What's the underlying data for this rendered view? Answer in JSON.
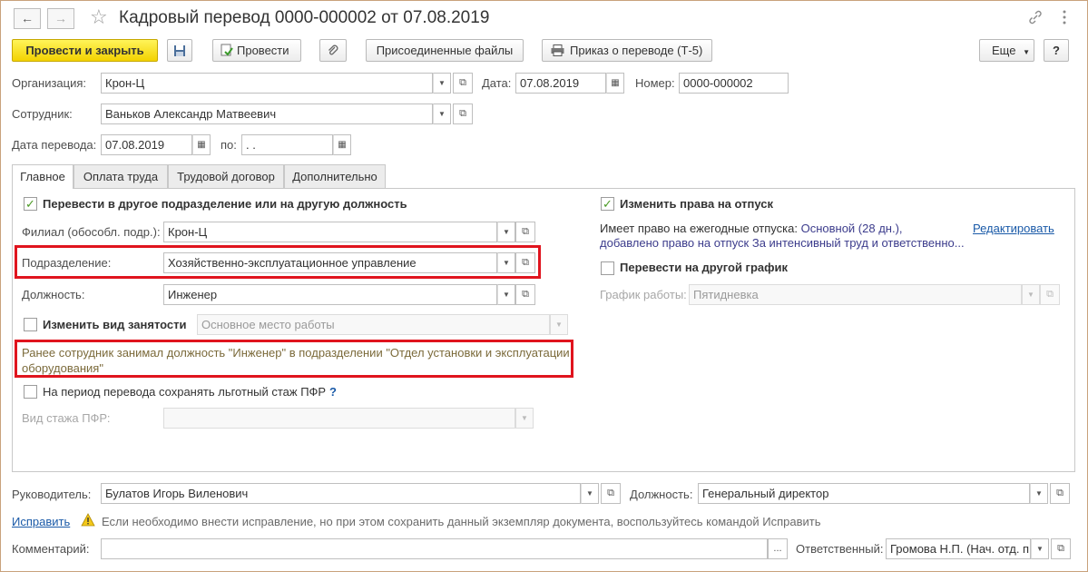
{
  "window": {
    "title": "Кадровый перевод 0000-000002 от 07.08.2019"
  },
  "toolbar": {
    "post_close": "Провести и закрыть",
    "post": "Провести",
    "attached_files": "Присоединенные файлы",
    "order": "Приказ о переводе (Т-5)",
    "more": "Еще",
    "help": "?"
  },
  "header": {
    "org_label": "Организация:",
    "org_value": "Крон-Ц",
    "date_label": "Дата:",
    "date_value": "07.08.2019",
    "number_label": "Номер:",
    "number_value": "0000-000002",
    "employee_label": "Сотрудник:",
    "employee_value": "Ваньков Александр Матвеевич",
    "transfer_date_label": "Дата перевода:",
    "transfer_date_value": "07.08.2019",
    "to_label": "по:",
    "to_value": " .  ."
  },
  "tabs": [
    {
      "label": "Главное"
    },
    {
      "label": "Оплата труда"
    },
    {
      "label": "Трудовой договор"
    },
    {
      "label": "Дополнительно"
    }
  ],
  "main": {
    "transfer_checkbox_label": "Перевести в другое подразделение или на другую должность",
    "branch_label": "Филиал (обособл. подр.):",
    "branch_value": "Крон-Ц",
    "department_label": "Подразделение:",
    "department_value": "Хозяйственно-эксплуатационное управление",
    "position_label": "Должность:",
    "position_value": "Инженер",
    "employment_type_label": "Изменить вид занятости",
    "employment_type_value": "Основное место работы",
    "prev_note": "Ранее сотрудник занимал должность \"Инженер\" в подразделении \"Отдел установки и эксплуатации оборудования\"",
    "keep_pfr_label": "На период перевода сохранять льготный стаж ПФР",
    "pfr_help": "?",
    "pfr_type_label": "Вид стажа ПФР:",
    "pfr_type_value": "",
    "vacation_checkbox_label": "Изменить права на отпуск",
    "vacation_rights_prefix": "Имеет право на ежегодные отпуска:",
    "vacation_rights_value": "Основной (28 дн.),",
    "vacation_added": "добавлено право на отпуск За интенсивный труд и ответственно...",
    "edit_link": "Редактировать",
    "schedule_checkbox_label": "Перевести на другой график",
    "schedule_label": "График работы:",
    "schedule_value": "Пятидневка"
  },
  "footer": {
    "manager_label": "Руководитель:",
    "manager_value": "Булатов Игорь Виленович",
    "manager_position_label": "Должность:",
    "manager_position_value": "Генеральный директор",
    "fix_link": "Исправить",
    "fix_note": "Если необходимо внести исправление, но при этом сохранить данный экземпляр документа, воспользуйтесь командой Исправить",
    "comment_label": "Комментарий:",
    "comment_value": "",
    "responsible_label": "Ответственный:",
    "responsible_value": "Громова Н.П. (Нач. отд. п"
  },
  "colors": {
    "primary_button": "#f3d200",
    "highlight_border": "#e0141e",
    "link": "#1a5aa8",
    "checkmark": "#4a9a24"
  }
}
